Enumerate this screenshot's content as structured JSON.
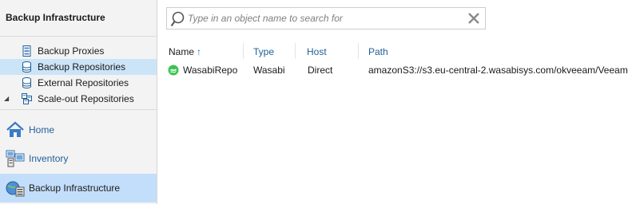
{
  "left_pane": {
    "title": "Backup Infrastructure",
    "tree": [
      {
        "label": "Backup Proxies",
        "icon": "server-icon"
      },
      {
        "label": "Backup Repositories",
        "icon": "database-icon",
        "selected": true
      },
      {
        "label": "External Repositories",
        "icon": "database-icon"
      },
      {
        "label": "Scale-out Repositories",
        "icon": "scale-out-icon",
        "expander": "◢"
      }
    ],
    "nav": [
      {
        "label": "Home",
        "icon": "home-icon"
      },
      {
        "label": "Inventory",
        "icon": "inventory-icon"
      },
      {
        "label": "Backup Infrastructure",
        "icon": "backup-infrastructure-icon",
        "active": true
      }
    ]
  },
  "search": {
    "placeholder": "Type in an object name to search for",
    "value": ""
  },
  "table": {
    "columns": [
      "Name",
      "Type",
      "Host",
      "Path"
    ],
    "sort_indicator": "↑",
    "rows": [
      {
        "name": "WasabiRepo",
        "type": "Wasabi",
        "host": "Direct",
        "path": "amazonS3://s3.eu-central-2.wasabisys.com/okveeam/Veeam",
        "icon": "wasabi-icon"
      }
    ]
  },
  "colors": {
    "selection": "#cce4f7",
    "nav_active": "#c3defa",
    "link_blue": "#1f5f96",
    "wasabi_green": "#3ec252"
  }
}
